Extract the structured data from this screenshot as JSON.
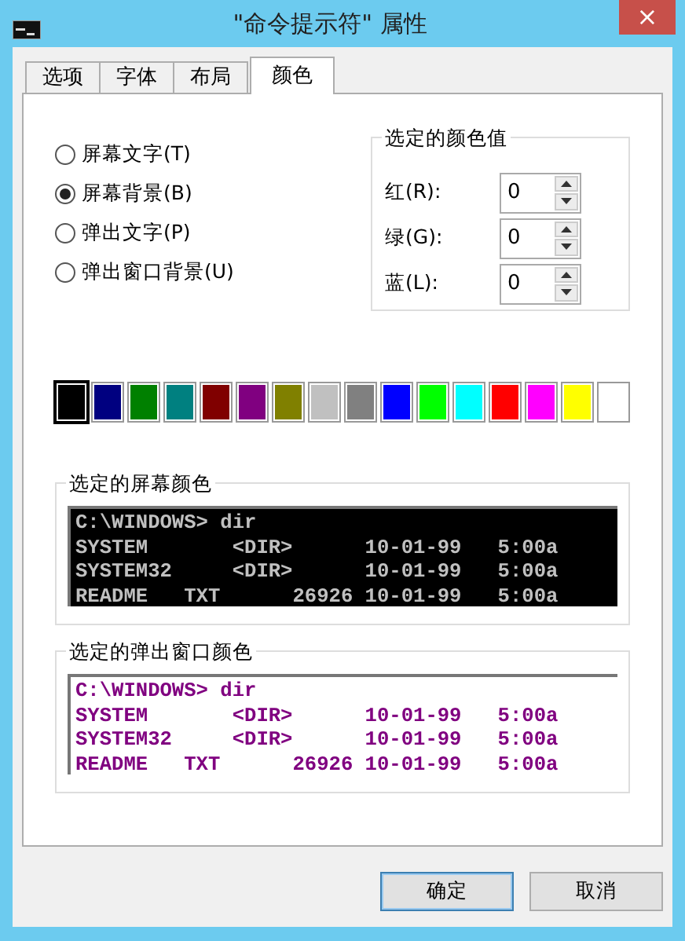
{
  "window": {
    "title": "\"命令提示符\" 属性",
    "close": "×"
  },
  "tabs": [
    {
      "label": "选项",
      "selected": false
    },
    {
      "label": "字体",
      "selected": false
    },
    {
      "label": "布局",
      "selected": false
    },
    {
      "label": "颜色",
      "selected": true
    }
  ],
  "targets": [
    {
      "label": "屏幕文字(T)",
      "selected": false
    },
    {
      "label": "屏幕背景(B)",
      "selected": true
    },
    {
      "label": "弹出文字(P)",
      "selected": false
    },
    {
      "label": "弹出窗口背景(U)",
      "selected": false
    }
  ],
  "color_values": {
    "title": "选定的颜色值",
    "fields": [
      {
        "label": "红(R):",
        "value": "0"
      },
      {
        "label": "绿(G):",
        "value": "0"
      },
      {
        "label": "蓝(L):",
        "value": "0"
      }
    ]
  },
  "palette": [
    {
      "color": "#000000",
      "selected": true
    },
    {
      "color": "#000080",
      "selected": false
    },
    {
      "color": "#008000",
      "selected": false
    },
    {
      "color": "#008080",
      "selected": false
    },
    {
      "color": "#800000",
      "selected": false
    },
    {
      "color": "#800080",
      "selected": false
    },
    {
      "color": "#808000",
      "selected": false
    },
    {
      "color": "#c0c0c0",
      "selected": false
    },
    {
      "color": "#808080",
      "selected": false
    },
    {
      "color": "#0000ff",
      "selected": false
    },
    {
      "color": "#00ff00",
      "selected": false
    },
    {
      "color": "#00ffff",
      "selected": false
    },
    {
      "color": "#ff0000",
      "selected": false
    },
    {
      "color": "#ff00ff",
      "selected": false
    },
    {
      "color": "#ffff00",
      "selected": false
    },
    {
      "color": "#ffffff",
      "selected": false
    }
  ],
  "previews": [
    {
      "title": "选定的屏幕颜色",
      "kind": "screen",
      "lines": [
        "C:\\WINDOWS> dir",
        "SYSTEM       <DIR>      10-01-99   5:00a",
        "SYSTEM32     <DIR>      10-01-99   5:00a",
        "README   TXT      26926 10-01-99   5:00a"
      ]
    },
    {
      "title": "选定的弹出窗口颜色",
      "kind": "popup",
      "lines": [
        "C:\\WINDOWS> dir",
        "SYSTEM       <DIR>      10-01-99   5:00a",
        "SYSTEM32     <DIR>      10-01-99   5:00a",
        "README   TXT      26926 10-01-99   5:00a"
      ]
    }
  ],
  "buttons": [
    {
      "label": "确定",
      "default": true
    },
    {
      "label": "取消",
      "default": false
    }
  ]
}
